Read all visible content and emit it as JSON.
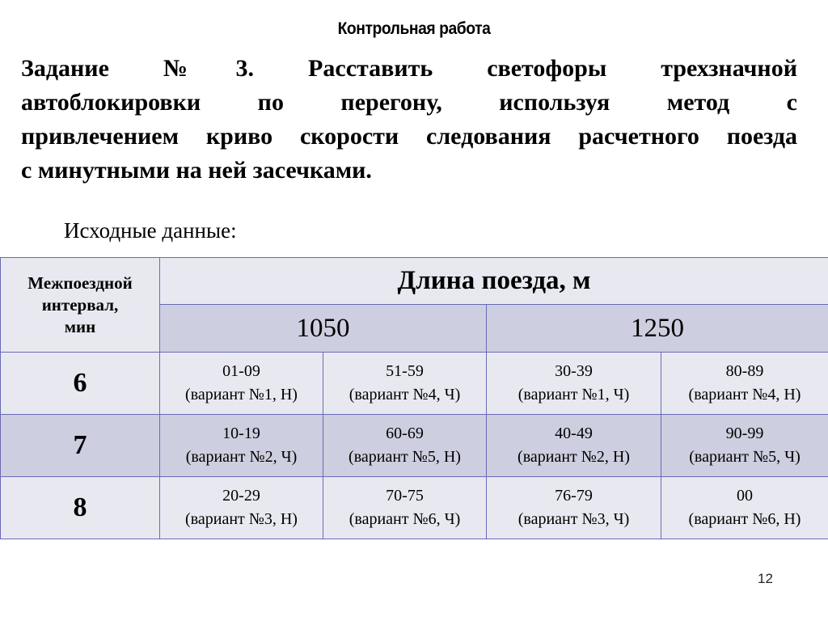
{
  "slide": {
    "title": "Контрольная работа",
    "task_lines": [
      "Задание №3. Расставить светофоры трехзначной",
      "автоблокировки по перегону, используя метод с",
      "привлечением криво скорости следования расчетного поезда",
      "с минутными на ней засечками."
    ],
    "subtitle": "Исходные данные:",
    "page_number": "12"
  },
  "table": {
    "interval_header": [
      "Межпоездной",
      "интервал,",
      "мин"
    ],
    "length_header": "Длина поезда, м",
    "lengths": [
      "1050",
      "1250"
    ],
    "rows": [
      {
        "interval": "6",
        "cells": [
          {
            "range": "01-09",
            "variant": "(вариант №1, Н)"
          },
          {
            "range": "51-59",
            "variant": "(вариант №4, Ч)"
          },
          {
            "range": "30-39",
            "variant": "(вариант №1, Ч)"
          },
          {
            "range": "80-89",
            "variant": "(вариант №4, Н)"
          }
        ]
      },
      {
        "interval": "7",
        "cells": [
          {
            "range": "10-19",
            "variant": "(вариант №2, Ч)"
          },
          {
            "range": "60-69",
            "variant": "(вариант №5, Н)"
          },
          {
            "range": "40-49",
            "variant": "(вариант №2, Н)"
          },
          {
            "range": "90-99",
            "variant": "(вариант №5, Ч)"
          }
        ]
      },
      {
        "interval": "8",
        "cells": [
          {
            "range": "20-29",
            "variant": "(вариант №3, Н)"
          },
          {
            "range": "70-75",
            "variant": "(вариант №6, Ч)"
          },
          {
            "range": "76-79",
            "variant": "(вариант №3, Ч)"
          },
          {
            "range": "00",
            "variant": "(вариант №6, Н)"
          }
        ]
      }
    ]
  },
  "colors": {
    "row_light": "#e8e9f0",
    "row_dark": "#cdcedf",
    "border": "#6a6ab8"
  }
}
